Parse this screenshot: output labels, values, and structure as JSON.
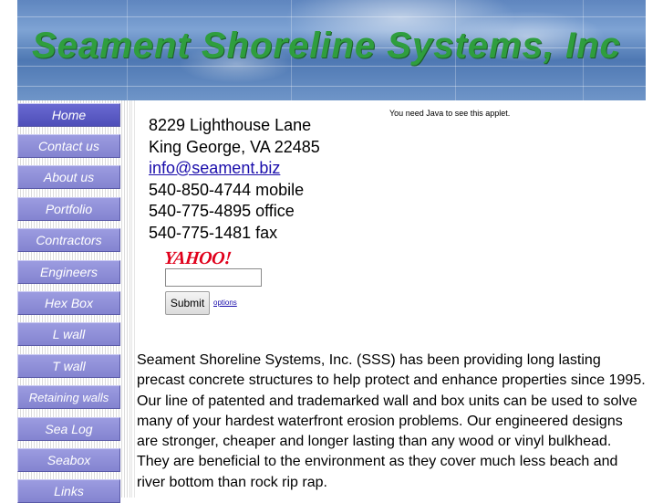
{
  "banner": {
    "title": "Seament Shoreline Systems, Inc"
  },
  "nav": {
    "items": [
      {
        "label": "Home",
        "active": true
      },
      {
        "label": "Contact us"
      },
      {
        "label": "About us"
      },
      {
        "label": "Portfolio"
      },
      {
        "label": "Contractors"
      },
      {
        "label": "Engineers"
      },
      {
        "label": "Hex Box"
      },
      {
        "label": "L wall"
      },
      {
        "label": "T wall"
      },
      {
        "label": "Retaining walls"
      },
      {
        "label": "Sea Log"
      },
      {
        "label": "Seabox"
      },
      {
        "label": "Links"
      }
    ]
  },
  "contact": {
    "street": "8229 Lighthouse Lane",
    "city": "King George, VA 22485",
    "email": "info@seament.biz",
    "mobile": "540-850-4744 mobile",
    "office": "540-775-4895 office",
    "fax": "540-775-1481 fax"
  },
  "applet": {
    "message": "You need Java to see this applet."
  },
  "yahoo": {
    "logo": "YAHOO!",
    "search_value": "",
    "submit_label": "Submit",
    "options_label": "options"
  },
  "intro": {
    "text": "Seament Shoreline Systems, Inc. (SSS) has been providing long lasting precast concrete structures to help protect and enhance properties since 1995. Our line of patented and trademarked wall and box units can be used to solve many of your hardest waterfront erosion problems. Our engineered designs are stronger, cheaper and longer lasting than any wood or vinyl bulkhead. They are beneficial to the environment as they cover much less beach and river bottom than rock rip rap."
  },
  "colors": {
    "title_green": "#2f9e3e",
    "nav_button": "#8c8cd8",
    "nav_active": "#5a5ac4",
    "link_blue": "#1a0dab",
    "yahoo_red": "#e0001b"
  }
}
